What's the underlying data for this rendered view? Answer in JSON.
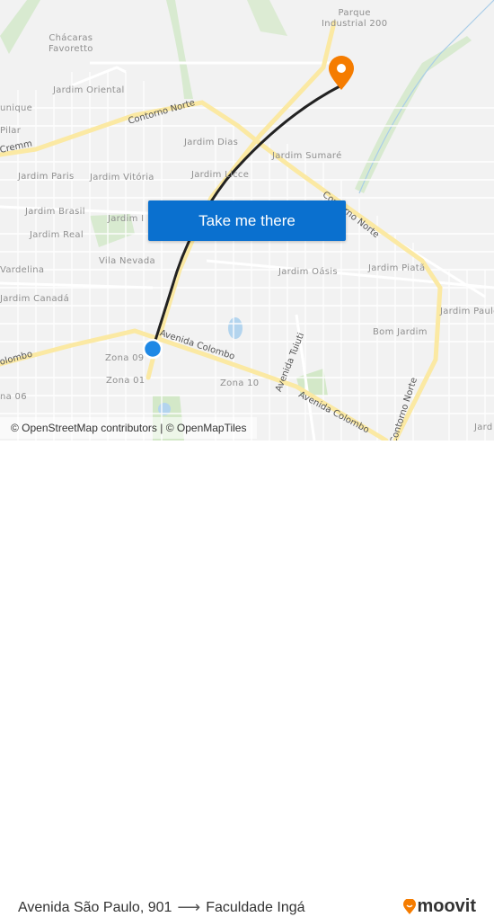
{
  "map": {
    "labels": {
      "parque_industrial": "Parque\nIndustrial 200",
      "chacaras": "Chácaras\nFavoretto",
      "jardim_oriental": "Jardim Oriental",
      "unique": "unique",
      "pilar": "Pilar",
      "jardim_dias": "Jardim Dias",
      "jardim_paris": "Jardim Paris",
      "jardim_vitoria": "Jardim Vitória",
      "jardim_licce": "Jardim Licce",
      "jardim_sumare": "Jardim Sumaré",
      "jardim_brasil": "Jardim Brasil",
      "jardim_i": "Jardim I",
      "jardim_real": "Jardim Real",
      "vardelina": "Vardelina",
      "vila_nevada": "Vila Nevada",
      "jardim_oasis": "Jardim Oásis",
      "jardim_piata": "Jardim Piatã",
      "jardim_canada": "Jardim Canadá",
      "jardim_paulo": "Jardim Paulo",
      "bom_jardim": "Bom Jardim",
      "zona_09": "Zona 09",
      "zona_01": "Zona 01",
      "zona_10": "Zona 10",
      "zona_06": "na 06",
      "jard": "Jard"
    },
    "roads": {
      "contorno_norte_w": "Contorno Norte",
      "contorno_norte_e": "Contorno Norte",
      "contorno_norte_s": "Contorno Norte",
      "cremm": "Cremm",
      "avenida_colombo_1": "Avenida Colombo",
      "avenida_colombo_2": "Avenida Colombo",
      "colombo_w": "olombo",
      "avenida_tuiuti": "Avenida Tuiuti"
    },
    "colors": {
      "route": "#222222",
      "origin": "#1e88e5",
      "destination": "#f57c00",
      "major_road": "#fbe9a3"
    }
  },
  "cta": {
    "label": "Take me there"
  },
  "attribution": "© OpenStreetMap contributors | © OpenMapTiles",
  "footer": {
    "origin": "Avenida São Paulo, 901",
    "arrow": "⟶",
    "destination": "Faculdade Ingá",
    "logo": "moovit"
  }
}
